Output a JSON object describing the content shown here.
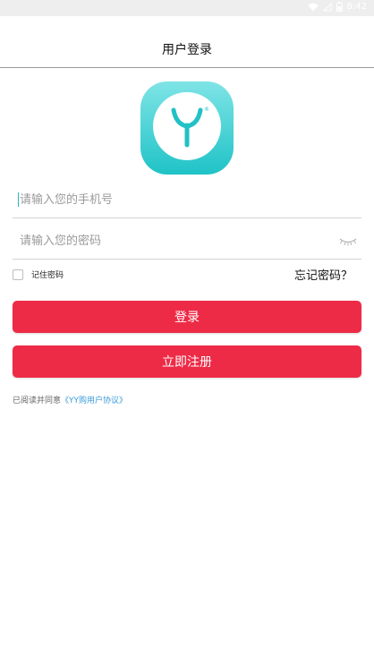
{
  "status_bar": {
    "time": "8:42",
    "icons": [
      "wifi-icon",
      "no-signal-icon",
      "battery-icon"
    ]
  },
  "header": {
    "title": "用户登录"
  },
  "logo": {
    "letter": "Y",
    "registered_mark": "®",
    "colors": {
      "outer_top": "#7fe4e6",
      "outer_bottom": "#1fc3c7",
      "inner": "#ffffff",
      "letter": "#22c1c6"
    }
  },
  "form": {
    "phone_placeholder": "请输入您的手机号",
    "password_placeholder": "请输入您的密码",
    "remember_label": "记住密码",
    "forgot_label": "忘记密码？"
  },
  "buttons": {
    "login_label": "登录",
    "register_label": "立即注册",
    "color": "#ee2b47"
  },
  "agreement": {
    "prefix": "已阅读并同意",
    "link_text": "《YY购用户协议》",
    "link_color": "#3a9bd8"
  }
}
